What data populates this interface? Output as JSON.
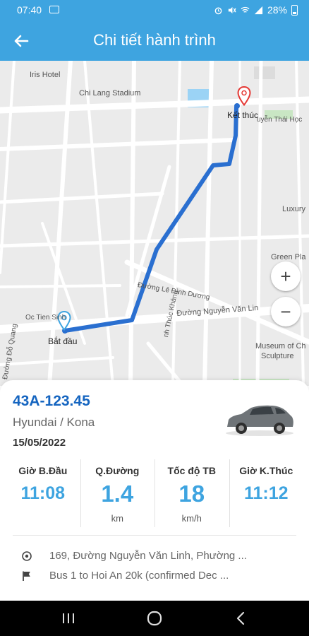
{
  "status_bar": {
    "time": "07:40",
    "battery": "28%"
  },
  "app_bar": {
    "title": "Chi tiết hành trình",
    "back_icon": "arrow-left-icon"
  },
  "map": {
    "labels": {
      "iris_hotel": "Iris Hotel",
      "chi_lang": "Chi Lang Stadium",
      "ket_thuc": "Kết thúc",
      "nguyen_thai_hoc": "uyễn Thái Học",
      "luxury": "Luxury",
      "green_pla": "Green Pla",
      "le_dinh_duong": "Đường Lê Đình Dương",
      "nguyen_van_linh": "Đường Nguyễn Văn Lin",
      "oc_tien": "Oc Tien Sinh",
      "bat_dau": "Bắt đầu",
      "thuc_khang": "nh Thúc Kháng",
      "do_quang": "Đường Đỗ Quang",
      "museum_1": "Museum of Ch",
      "museum_2": "Sculpture"
    },
    "zoom_in": "+",
    "zoom_out": "−"
  },
  "trip": {
    "plate": "43A-123.45",
    "vehicle": "Hyundai / Kona",
    "date": "15/05/2022",
    "stats": [
      {
        "label": "Giờ B.Đầu",
        "value": "11:08",
        "unit": ""
      },
      {
        "label": "Q.Đường",
        "value": "1.4",
        "unit": "km"
      },
      {
        "label": "Tốc độ TB",
        "value": "18",
        "unit": "km/h"
      },
      {
        "label": "Giờ K.Thúc",
        "value": "11:12",
        "unit": ""
      }
    ],
    "start_address": "169, Đường Nguyễn Văn Linh, Phường ...",
    "end_address": "Bus 1 to Hoi An 20k (confirmed Dec ..."
  },
  "colors": {
    "accent": "#3ea4e0",
    "plate": "#1565c0",
    "route": "#2a6fd0",
    "end_marker": "#e53935"
  }
}
